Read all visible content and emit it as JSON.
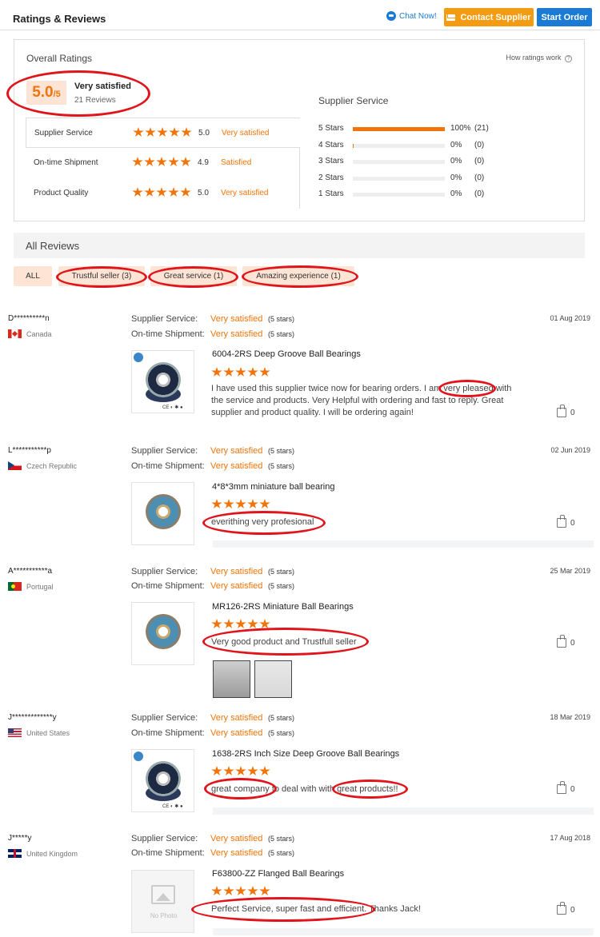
{
  "header": {
    "title": "Ratings & Reviews",
    "chat_label": "Chat Now!",
    "contact_label": "Contact Supplier",
    "start_label": "Start Order"
  },
  "overall": {
    "title": "Overall Ratings",
    "how_link": "How ratings work",
    "score": "5.0",
    "score_max": "/5",
    "score_label": "Very satisfied",
    "review_count": "21 Reviews",
    "subratings": [
      {
        "label": "Supplier Service",
        "value": "5.0",
        "text": "Very satisfied"
      },
      {
        "label": "On-time Shipment",
        "value": "4.9",
        "text": "Satisfied"
      },
      {
        "label": "Product Quality",
        "value": "5.0",
        "text": "Very satisfied"
      }
    ],
    "service_title": "Supplier Service",
    "distribution": [
      {
        "label": "5 Stars",
        "fraction": 1.0,
        "pct": "100%",
        "count": "(21)"
      },
      {
        "label": "4 Stars",
        "fraction": 0.01,
        "pct": "0%",
        "count": "(0)"
      },
      {
        "label": "3 Stars",
        "fraction": 0,
        "pct": "0%",
        "count": "(0)"
      },
      {
        "label": "2 Stars",
        "fraction": 0,
        "pct": "0%",
        "count": "(0)"
      },
      {
        "label": "1 Stars",
        "fraction": 0,
        "pct": "0%",
        "count": "(0)"
      }
    ]
  },
  "all_reviews_title": "All Reviews",
  "tags": [
    "ALL",
    "Trustful seller (3)",
    "Great service (1)",
    "Amazing experience (1)"
  ],
  "labels": {
    "supplier_service": "Supplier Service:",
    "ontime_shipment": "On-time Shipment:",
    "five_stars": "(5 stars)",
    "no_photo": "No Photo"
  },
  "reviews": [
    {
      "user": "D**********n",
      "country": "Canada",
      "service": "Very satisfied",
      "shipment": "Very satisfied",
      "date": "01 Aug 2019",
      "product": "6004-2RS Deep Groove Ball Bearings",
      "text": "I have used this supplier twice now for bearing orders. I am very pleased with the service and products. Very Helpful with ordering and fast to reply. Great supplier and product quality. I will be ordering again!",
      "likes": "0"
    },
    {
      "user": "L***********p",
      "country": "Czech Republic",
      "service": "Very satisfied",
      "shipment": "Very satisfied",
      "date": "02 Jun 2019",
      "product": "4*8*3mm miniature ball bearing",
      "text": "everithing very profesional",
      "likes": "0"
    },
    {
      "user": "A***********a",
      "country": "Portugal",
      "service": "Very satisfied",
      "shipment": "Very satisfied",
      "date": "25 Mar 2019",
      "product": "MR126-2RS Miniature Ball Bearings",
      "text": "Very good product and Trustfull seller",
      "likes": "0"
    },
    {
      "user": "J*************y",
      "country": "United States",
      "service": "Very satisfied",
      "shipment": "Very satisfied",
      "date": "18 Mar 2019",
      "product": "1638-2RS Inch Size Deep Groove Ball Bearings",
      "text": "great company to deal with with great products!!",
      "likes": "0"
    },
    {
      "user": "J*****y",
      "country": "United Kingdom",
      "service": "Very satisfied",
      "shipment": "Very satisfied",
      "date": "17 Aug 2018",
      "product": "F63800-ZZ Flanged Ball Bearings",
      "text": "Perfect Service, super fast and efficient. Thanks Jack!",
      "likes": "0"
    }
  ],
  "colors": {
    "accent": "#f0740a",
    "brand_blue": "#1a7ad4",
    "highlight_oval": "#e0141a"
  }
}
